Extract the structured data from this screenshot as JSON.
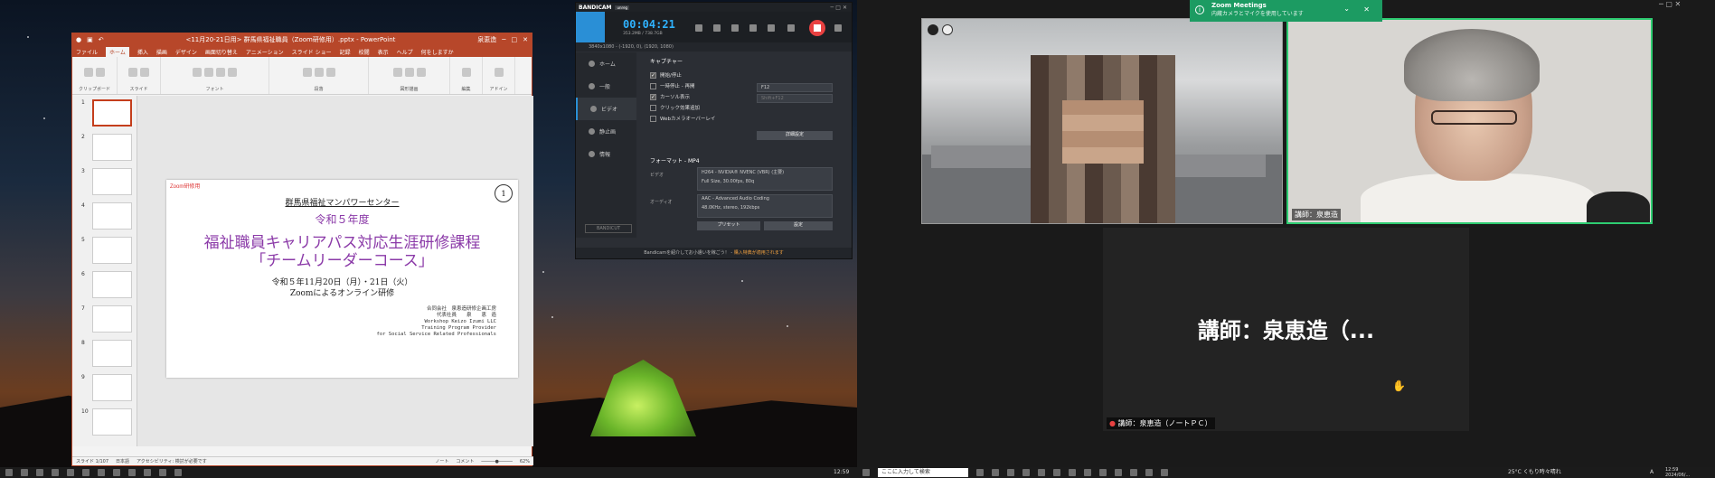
{
  "powerpoint": {
    "title": "<11月20-21日用> 群馬県福祉職員（Zoom研修用）.pptx - PowerPoint",
    "user": "泉恵造",
    "tabs": [
      "ファイル",
      "ホーム",
      "挿入",
      "描画",
      "デザイン",
      "画面切り替え",
      "アニメーション",
      "スライド ショー",
      "記録",
      "校閲",
      "表示",
      "ヘルプ",
      "何をしますか"
    ],
    "ribbon_groups": [
      "クリップボード",
      "スライド",
      "フォント",
      "段落",
      "図形描画",
      "編集",
      "アドイン"
    ],
    "thumbnail_numbers": [
      "1",
      "2",
      "3",
      "4",
      "5",
      "6",
      "7",
      "8",
      "9",
      "10"
    ],
    "slide": {
      "tag": "Zoom研修用",
      "number": "1",
      "org": "群馬県福祉マンパワーセンター",
      "year": "令和５年度",
      "title_line1": "福祉職員キャリアパス対応生涯研修課程",
      "title_line2": "「チームリーダーコース」",
      "date": "令和５年11月20日（月）・21日（火）",
      "mode": "Zoomによるオンライン研修",
      "credit1": "合同会社　泉恵造研修企画工房",
      "credit2": "代表社員　　泉　　恵　造",
      "credit3": "Workshop Keizo Izumi LLC",
      "credit4": "Training Program Provider",
      "credit5": "for Social Service Related Professionals"
    },
    "status_slide": "スライド 1/107",
    "status_lang": "日本語",
    "status_access": "アクセシビリティ: 検討が必要です",
    "status_note": "ノート",
    "status_comment": "コメント",
    "zoom": "62%"
  },
  "bandicam": {
    "brand": "BANDICAM",
    "edition": "unreg",
    "timer": "00:04:21",
    "size": "353.2MB / 738.7GB",
    "resolution": "3840x1080 - (-1920, 0), (1920, 1080)",
    "nav": [
      "ホーム",
      "一般",
      "ビデオ",
      "静止画",
      "情報"
    ],
    "nav_active": 2,
    "capture_header": "キャプチャー",
    "options": [
      {
        "label": "開始/停止",
        "checked": true
      },
      {
        "label": "一時停止 - 再開",
        "checked": false
      },
      {
        "label": "カーソル表示",
        "checked": true
      },
      {
        "label": "クリック効果追加",
        "checked": false
      },
      {
        "label": "Webカメラオーバーレイ",
        "checked": false
      }
    ],
    "hotkey1": "F12",
    "hotkey2": "Shift+F12",
    "detail_button": "詳細設定",
    "format_header": "フォーマット - MP4",
    "video_label": "ビデオ",
    "video_line1": "H264 - NVIDIA® NVENC (VBR) (主要)",
    "video_line2": "Full Size, 30.00fps, 80q",
    "audio_label": "オーディオ",
    "audio_line1": "AAC - Advanced Audio Coding",
    "audio_line2": "48.0KHz, stereo, 192kbps",
    "preset_button": "プリセット",
    "settings_button": "設定",
    "logo": "BANDICUT",
    "footer": "Bandicamを紹介してお小遣いを稼ごう！ -",
    "footer_link": "購入特典が適用されます"
  },
  "zoom": {
    "notif_title": "Zoom Meetings",
    "notif_desc": "内蔵カメラとマイクを使用しています",
    "tile2_label": "講師：泉恵造",
    "active_speaker": "講師：泉恵造（...",
    "active_label": "講師：泉恵造（ノートＰＣ）"
  },
  "taskbar_left": {
    "time": "12:59"
  },
  "taskbar_right": {
    "search_placeholder": "ここに入力して検索",
    "weather": "25°C くもり時々晴れ",
    "ime": "A",
    "time": "12:59",
    "date": "2024/06/..."
  },
  "colors": {
    "ppt_red": "#b7472a",
    "bandicam_blue": "#2a8fd6",
    "zoom_green": "#1c9b62",
    "speaker_border": "#2ecc71"
  }
}
